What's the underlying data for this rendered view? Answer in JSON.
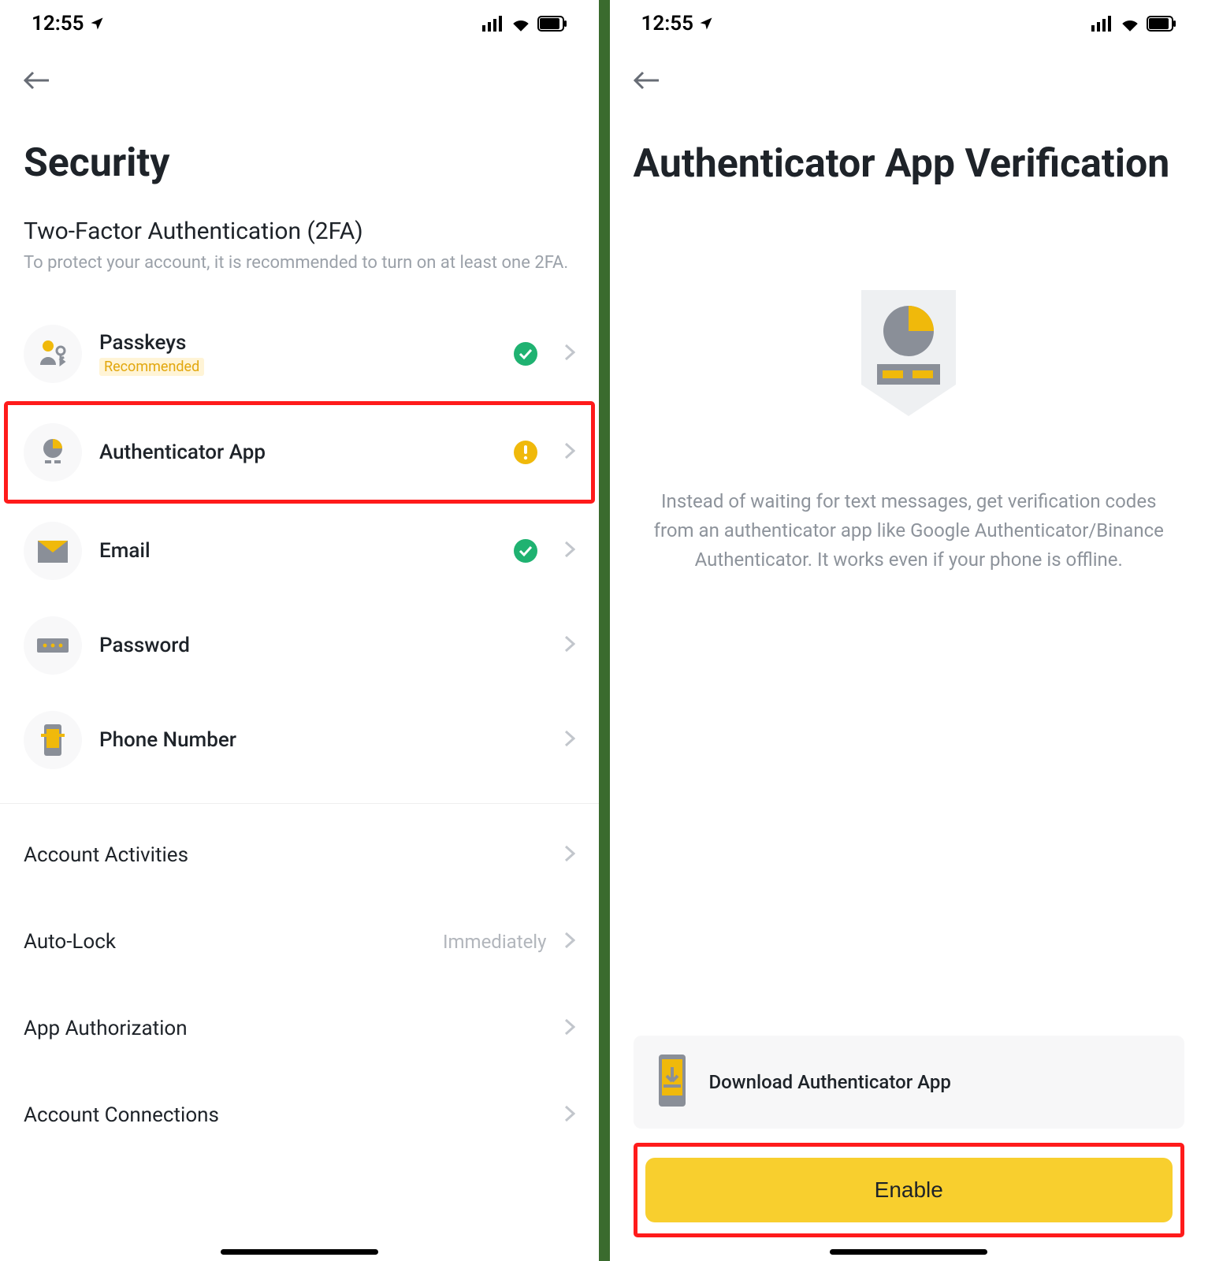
{
  "status": {
    "time": "12:55"
  },
  "left_screen": {
    "title": "Security",
    "section_title": "Two-Factor Authentication (2FA)",
    "section_desc": "To protect your account, it is recommended to turn on at least one 2FA.",
    "items": [
      {
        "label": "Passkeys",
        "badge": "Recommended"
      },
      {
        "label": "Authenticator App"
      },
      {
        "label": "Email"
      },
      {
        "label": "Password"
      },
      {
        "label": "Phone Number"
      }
    ],
    "settings": [
      {
        "label": "Account Activities",
        "value": ""
      },
      {
        "label": "Auto-Lock",
        "value": "Immediately"
      },
      {
        "label": "App Authorization",
        "value": ""
      },
      {
        "label": "Account Connections",
        "value": ""
      }
    ]
  },
  "right_screen": {
    "title": "Authenticator App Verification",
    "description": "Instead of waiting for text messages, get verification codes from an authenticator app like Google Authenticator/Binance Authenticator. It works even if your phone is offline.",
    "download_label": "Download Authenticator App",
    "enable_label": "Enable"
  }
}
